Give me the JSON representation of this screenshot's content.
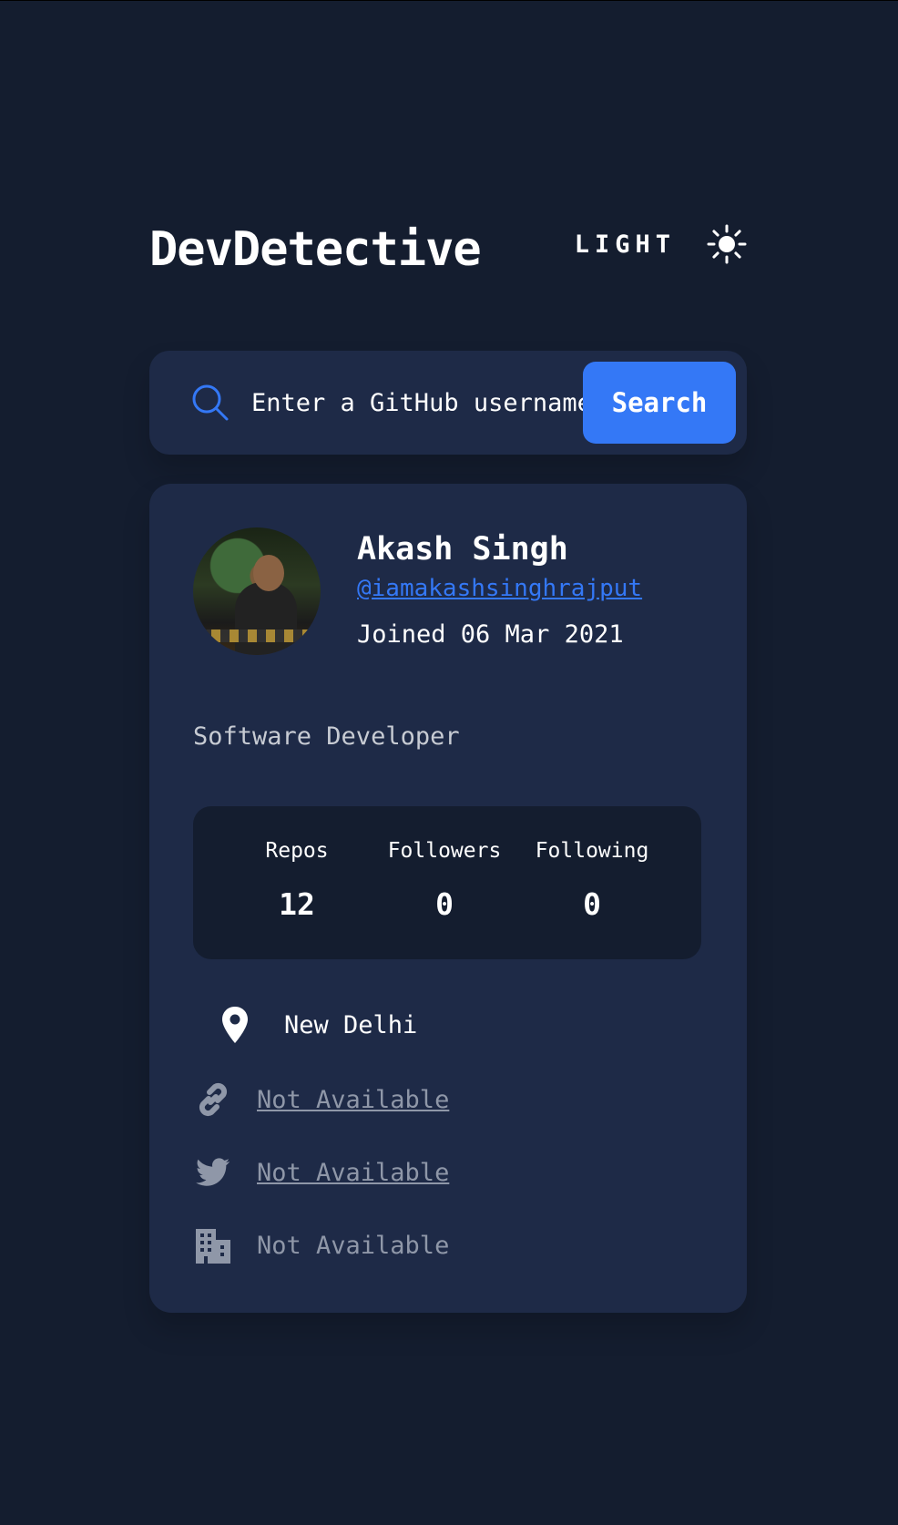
{
  "app": {
    "title": "DevDetective",
    "mode_label": "LIGHT",
    "mode_icon": "sun-icon"
  },
  "search": {
    "placeholder": "Enter a GitHub username...",
    "button_label": "Search",
    "icon": "search-icon"
  },
  "profile": {
    "name": "Akash Singh",
    "handle": "@iamakashsinghrajput",
    "joined": "Joined 06 Mar 2021",
    "bio": "Software Developer",
    "stats": [
      {
        "label": "Repos",
        "value": "12"
      },
      {
        "label": "Followers",
        "value": "0"
      },
      {
        "label": "Following",
        "value": "0"
      }
    ],
    "links": {
      "location": {
        "icon": "location-pin-icon",
        "text": "New Delhi"
      },
      "website": {
        "icon": "link-icon",
        "text": "Not Available"
      },
      "twitter": {
        "icon": "twitter-icon",
        "text": "Not Available"
      },
      "company": {
        "icon": "building-icon",
        "text": "Not Available"
      }
    }
  },
  "colors": {
    "background": "#141d2f",
    "card": "#1e2a47",
    "accent": "#3478f6",
    "muted": "#8f97a8",
    "text": "#ffffff"
  }
}
